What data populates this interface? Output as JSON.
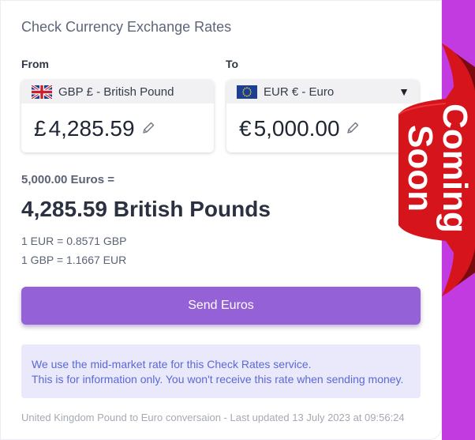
{
  "title": "Check Currency Exchange Rates",
  "from": {
    "label": "From",
    "currency_name": "GBP £ - British Pound",
    "symbol": "£",
    "amount": "4,285.59",
    "flag": "uk-flag-icon"
  },
  "to": {
    "label": "To",
    "currency_name": "EUR € - Euro",
    "symbol": "€",
    "amount": "5,000.00",
    "flag": "eu-flag-icon",
    "caret": "▼"
  },
  "conversion": {
    "source_line": "5,000.00 Euros =",
    "result_line": "4,285.59 British Pounds",
    "rate_1": "1 EUR = 0.8571 GBP",
    "rate_2": "1 GBP = 1.1667 EUR"
  },
  "send_button_label": "Send Euros",
  "notice": {
    "line_1": "We use the mid-market rate for this Check Rates service.",
    "line_2": "This is for information only. You won't receive this rate when sending money."
  },
  "footer": "United Kingdom Pound to Euro conversaion - Last updated 13 July 2023 at 09:56:24",
  "ribbon": {
    "text": "Coming\nSoon",
    "color": "#d6141b"
  },
  "colors": {
    "accent_button": "#9461d6",
    "side_strip": "#c23be0",
    "notice_bg": "#e9e9fb",
    "notice_text": "#5b68d6"
  }
}
